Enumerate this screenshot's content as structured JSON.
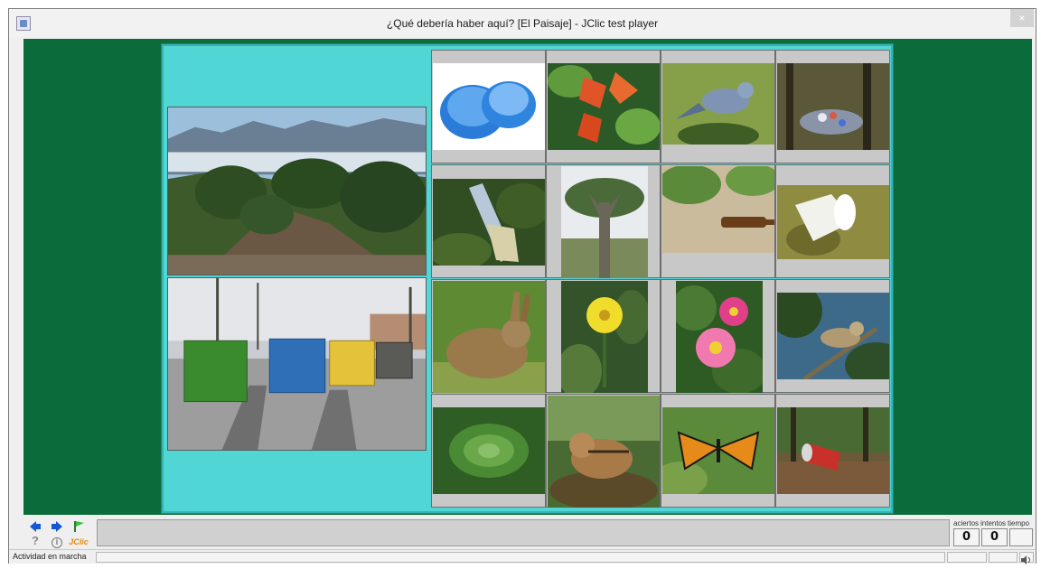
{
  "window": {
    "title": "¿Qué debería haber aquí? [El Paisaje] - JClic test player",
    "close_glyph": "×"
  },
  "activity": {
    "scenes": [
      {
        "name": "forest-landscape-scene"
      },
      {
        "name": "recycling-containers-scene"
      }
    ],
    "grid": [
      [
        "plastic bottle caps",
        "orange flowers",
        "blue bird",
        "littered forest"
      ],
      [
        "plastic bottle litter",
        "dragon tree",
        "bottle on sand",
        "plastic cup"
      ],
      [
        "rabbit",
        "yellow flower",
        "pink flowers",
        "finch on branch"
      ],
      [
        "succulent plant",
        "chipmunk",
        "monarch butterfly",
        "crushed can"
      ]
    ]
  },
  "toolbar": {
    "prev_icon": "arrow-left-icon",
    "next_icon": "arrow-right-icon",
    "reset_icon": "flag-icon",
    "help_glyph": "?",
    "info_glyph": "i",
    "brand": "JClic"
  },
  "counters": {
    "labels": [
      "aciertos",
      "intentos",
      "tiempo"
    ],
    "aciertos": "0",
    "intentos": "0",
    "tiempo": ""
  },
  "status": {
    "text": "Actividad en marcha",
    "sound_icon": "speaker-icon"
  },
  "colors": {
    "stage": "#0b6b3a",
    "panel": "#4fd6d5",
    "cell": "#c8c8c8"
  }
}
